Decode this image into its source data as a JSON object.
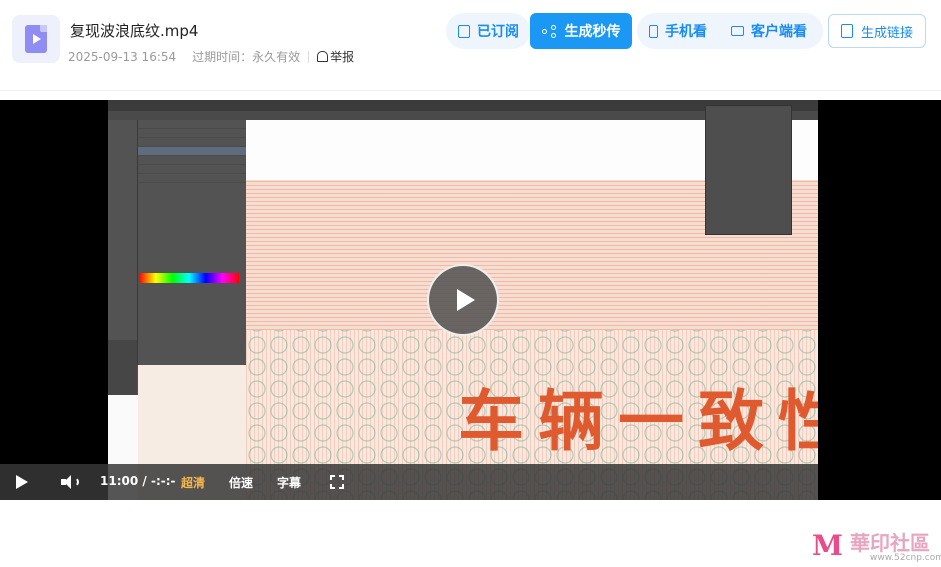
{
  "file": {
    "title": "复现波浪底纹.mp4",
    "date": "2025-09-13 16:54",
    "expiry": "过期时间：永久有效",
    "report": "举报"
  },
  "actions": {
    "subscribed": "已订阅",
    "generate_share": "生成秒传",
    "mobile_view": "手机看",
    "client_view": "客户端看",
    "generate_link": "生成链接"
  },
  "player": {
    "current_time": "11:00",
    "time_separator": "/",
    "duration": "-:-:-",
    "quality": "超清",
    "speed": "倍速",
    "subtitle": "字幕"
  },
  "video_frame": {
    "overlay_text": "车辆一致性"
  },
  "watermark": {
    "logo": "M",
    "name": "華印社區",
    "url": "www.52cnp.com"
  },
  "colors": {
    "accent": "#1a98f3",
    "quality_active": "#f5b84a",
    "overlay_text": "#e05a30"
  }
}
